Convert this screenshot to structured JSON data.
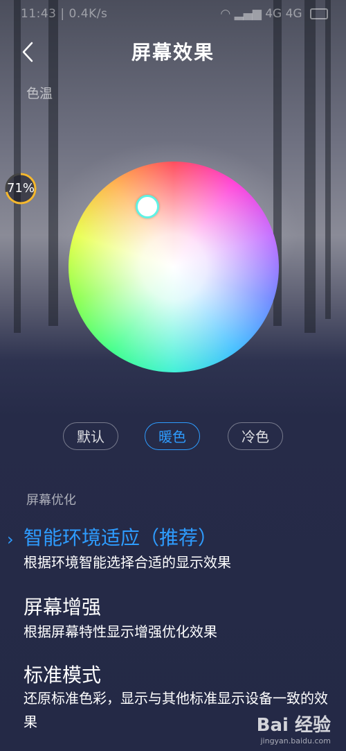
{
  "status_bar": {
    "time": "11:43",
    "speed": "0.4K/s",
    "network": "4G 4G"
  },
  "header": {
    "title": "屏幕效果",
    "back_icon": "chevron-left-icon"
  },
  "color_temp": {
    "label": "色温",
    "presets": [
      "默认",
      "暖色",
      "冷色"
    ],
    "selected": "暖色"
  },
  "speed_badge": {
    "value": "71%"
  },
  "optimization": {
    "label": "屏幕优化",
    "options": [
      {
        "title": "智能环境适应（推荐）",
        "desc": "根据环境智能选择合适的显示效果",
        "selected": true
      },
      {
        "title": "屏幕增强",
        "desc": "根据屏幕特性显示增强优化效果",
        "selected": false
      },
      {
        "title": "标准模式",
        "desc": "还原标准色彩，显示与其他标准显示设备一致的效果",
        "selected": false
      }
    ]
  },
  "watermark": {
    "text": "Bai 经验",
    "sub": "jingyan.baidu.com"
  },
  "colors": {
    "accent": "#2e9cff",
    "background": "#252a47",
    "picker_ring": "#5ff2e4"
  }
}
